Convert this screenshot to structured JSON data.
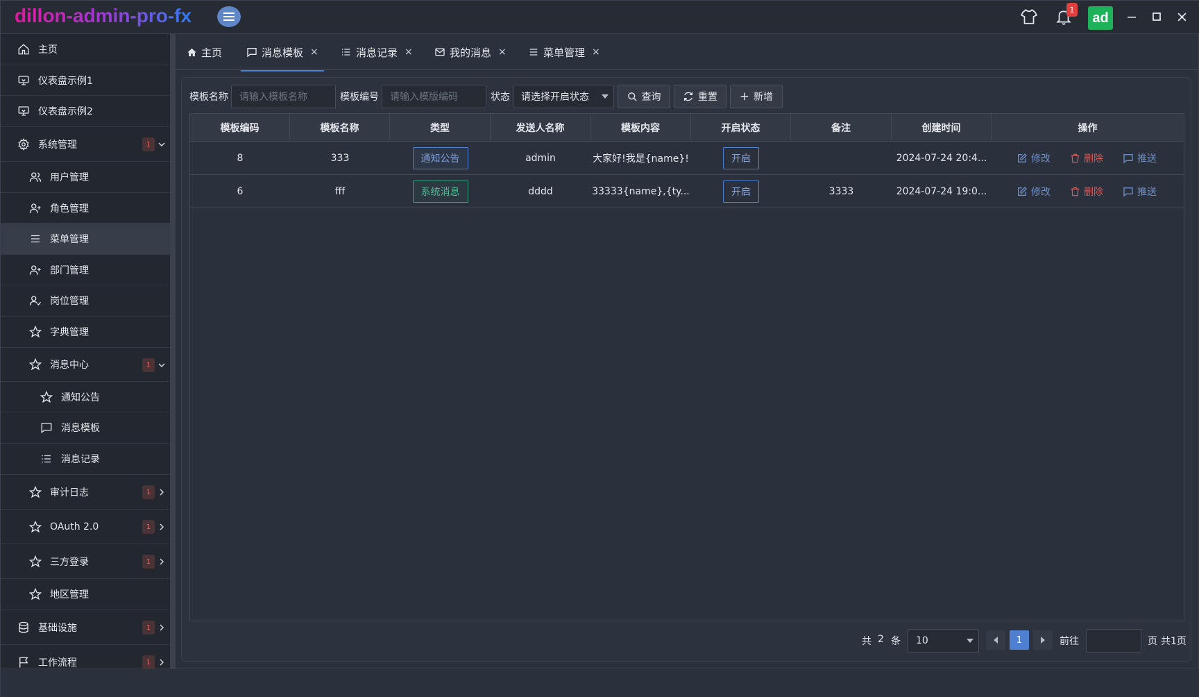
{
  "app": {
    "title": "dillon-admin-pro-fx",
    "avatar_text": "ad",
    "notification_count": "1"
  },
  "sidebar": {
    "items": [
      {
        "label": "主页",
        "icon": "home-icon"
      },
      {
        "label": "仪表盘示例1",
        "icon": "monitor-icon"
      },
      {
        "label": "仪表盘示例2",
        "icon": "monitor-icon"
      },
      {
        "label": "系统管理",
        "icon": "gear-icon",
        "badge": "1"
      },
      {
        "label": "用户管理",
        "icon": "users-icon"
      },
      {
        "label": "角色管理",
        "icon": "user-plus-icon"
      },
      {
        "label": "菜单管理",
        "icon": "list-icon",
        "active": true
      },
      {
        "label": "部门管理",
        "icon": "user-plus-icon"
      },
      {
        "label": "岗位管理",
        "icon": "user-check-icon"
      },
      {
        "label": "字典管理",
        "icon": "star-icon"
      },
      {
        "label": "消息中心",
        "icon": "star-icon",
        "badge": "1"
      },
      {
        "label": "通知公告",
        "icon": "star-icon"
      },
      {
        "label": "消息模板",
        "icon": "message-icon"
      },
      {
        "label": "消息记录",
        "icon": "list-icon"
      },
      {
        "label": "审计日志",
        "icon": "star-icon",
        "badge": "1"
      },
      {
        "label": "OAuth 2.0",
        "icon": "star-icon",
        "badge": "1"
      },
      {
        "label": "三方登录",
        "icon": "star-icon",
        "badge": "1"
      },
      {
        "label": "地区管理",
        "icon": "star-icon"
      },
      {
        "label": "基础设施",
        "icon": "database-icon",
        "badge": "1"
      },
      {
        "label": "工作流程",
        "icon": "flag-icon",
        "badge": "1"
      }
    ]
  },
  "tabs": [
    {
      "label": "主页",
      "icon": "home-icon",
      "closable": false
    },
    {
      "label": "消息模板",
      "icon": "message-icon",
      "closable": true,
      "active": true
    },
    {
      "label": "消息记录",
      "icon": "list-icon",
      "closable": true
    },
    {
      "label": "我的消息",
      "icon": "mail-icon",
      "closable": true
    },
    {
      "label": "菜单管理",
      "icon": "list-icon",
      "closable": true
    }
  ],
  "tab_close_glyph": "×",
  "filters": {
    "name_label": "模板名称",
    "name_placeholder": "请输入模板名称",
    "code_label": "模板编号",
    "code_placeholder": "请输入模版编码",
    "status_label": "状态",
    "status_placeholder": "请选择开启状态",
    "search_button": "查询",
    "reset_button": "重置",
    "add_button": "新增"
  },
  "table": {
    "columns": [
      "模板编码",
      "模板名称",
      "类型",
      "发送人名称",
      "模板内容",
      "开启状态",
      "备注",
      "创建时间",
      "操作"
    ],
    "rows": [
      {
        "code": "8",
        "name": "333",
        "type": "通知公告",
        "type_color": "blue",
        "sender": "admin",
        "content": "大家好!我是{name}!",
        "status": "开启",
        "remark": "",
        "created": "2024-07-24 20:4..."
      },
      {
        "code": "6",
        "name": "fff",
        "type": "系统消息",
        "type_color": "green",
        "sender": "dddd",
        "content": "33333{name},{ty...",
        "status": "开启",
        "remark": "3333",
        "created": "2024-07-24 19:0..."
      }
    ],
    "actions": {
      "edit": "修改",
      "delete": "删除",
      "push": "推送"
    }
  },
  "pagination": {
    "total_prefix": "共",
    "total": "2",
    "total_suffix": "条",
    "page_size": "10",
    "current_page": "1",
    "goto_label": "前往",
    "page_suffix": "页",
    "total_pages": "共1页"
  },
  "colors": {
    "accent": "#4f7fd0",
    "danger": "#d35a5a",
    "success": "#1db25a"
  }
}
